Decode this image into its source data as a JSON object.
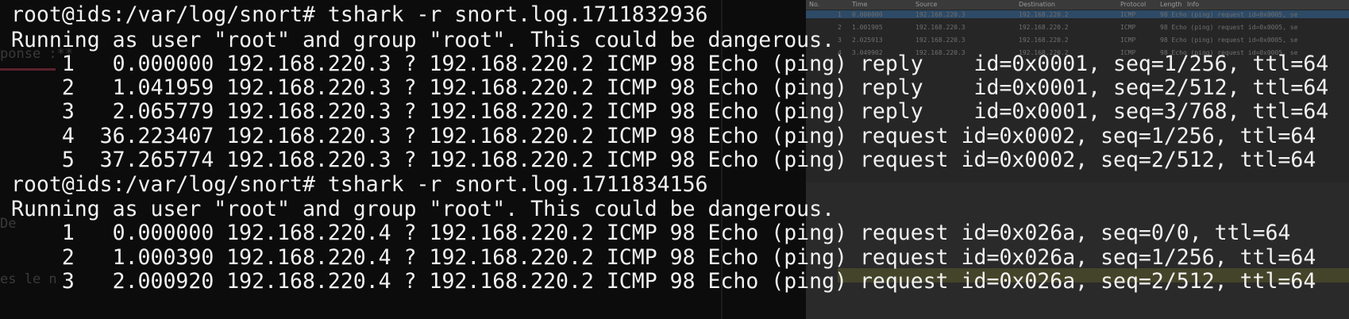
{
  "terminal": {
    "lines": [
      "root@ids:/var/log/snort# tshark -r snort.log.1711832936",
      "Running as user \"root\" and group \"root\". This could be dangerous.",
      "    1   0.000000 192.168.220.3 ? 192.168.220.2 ICMP 98 Echo (ping) reply    id=0x0001, seq=1/256, ttl=64",
      "    2   1.041959 192.168.220.3 ? 192.168.220.2 ICMP 98 Echo (ping) reply    id=0x0001, seq=2/512, ttl=64",
      "    3   2.065779 192.168.220.3 ? 192.168.220.2 ICMP 98 Echo (ping) reply    id=0x0001, seq=3/768, ttl=64",
      "    4  36.223407 192.168.220.3 ? 192.168.220.2 ICMP 98 Echo (ping) request id=0x0002, seq=1/256, ttl=64",
      "    5  37.265774 192.168.220.3 ? 192.168.220.2 ICMP 98 Echo (ping) request id=0x0002, seq=2/512, ttl=64",
      "root@ids:/var/log/snort# tshark -r snort.log.1711834156",
      "Running as user \"root\" and group \"root\". This could be dangerous.",
      "    1   0.000000 192.168.220.4 ? 192.168.220.2 ICMP 98 Echo (ping) request id=0x026a, seq=0/0, ttl=64",
      "    2   1.000390 192.168.220.4 ? 192.168.220.2 ICMP 98 Echo (ping) request id=0x026a, seq=1/256, ttl=64",
      "    3   2.000920 192.168.220.4 ? 192.168.220.2 ICMP 98 Echo (ping) request id=0x026a, seq=2/512, ttl=64"
    ]
  },
  "background": {
    "editor_fragments": [
      "ponse :**",
      "De",
      "es le n"
    ],
    "wireshark_columns": [
      "No.",
      "Time",
      "Source",
      "Destination",
      "Protocol",
      "Length",
      "Info"
    ],
    "wireshark_rows": [
      [
        "1",
        "0.000000",
        "192.168.220.3",
        "192.168.220.2",
        "ICMP",
        "98 Echo (ping) request  id=0x0005, se"
      ],
      [
        "2",
        "1.001905",
        "192.168.220.3",
        "192.168.220.2",
        "ICMP",
        "98 Echo (ping) request  id=0x0005, se"
      ],
      [
        "3",
        "2.025913",
        "192.168.220.3",
        "192.168.220.2",
        "ICMP",
        "98 Echo (ping) request  id=0x0005, se"
      ],
      [
        "4",
        "3.049902",
        "192.168.220.3",
        "192.168.220.2",
        "ICMP",
        "98 Echo (ping) request  id=0x0005, se"
      ]
    ]
  },
  "colors": {
    "terminal_bg": "#0c0c0c",
    "terminal_fg": "#f2f2f2"
  }
}
